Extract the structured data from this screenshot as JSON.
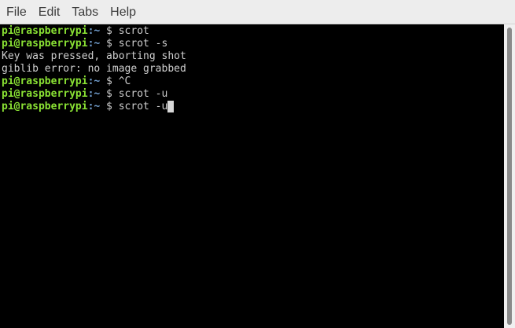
{
  "menu": {
    "file": "File",
    "edit": "Edit",
    "tabs": "Tabs",
    "help": "Help"
  },
  "prompt": {
    "user_host": "pi@raspberrypi",
    "path": ":~",
    "symbol": " $ "
  },
  "terminal": {
    "lines": [
      {
        "type": "prompt",
        "command": "scrot"
      },
      {
        "type": "prompt",
        "command": "scrot -s"
      },
      {
        "type": "output",
        "text": "Key was pressed, aborting shot"
      },
      {
        "type": "output",
        "text": "giblib error: no image grabbed"
      },
      {
        "type": "prompt",
        "command": "^C"
      },
      {
        "type": "prompt",
        "command": "scrot -u"
      },
      {
        "type": "prompt",
        "command": "scrot -u"
      }
    ]
  },
  "colors": {
    "user_host": "#8ae234",
    "path": "#729fcf",
    "text": "#cfcfcf",
    "background": "#000000"
  }
}
